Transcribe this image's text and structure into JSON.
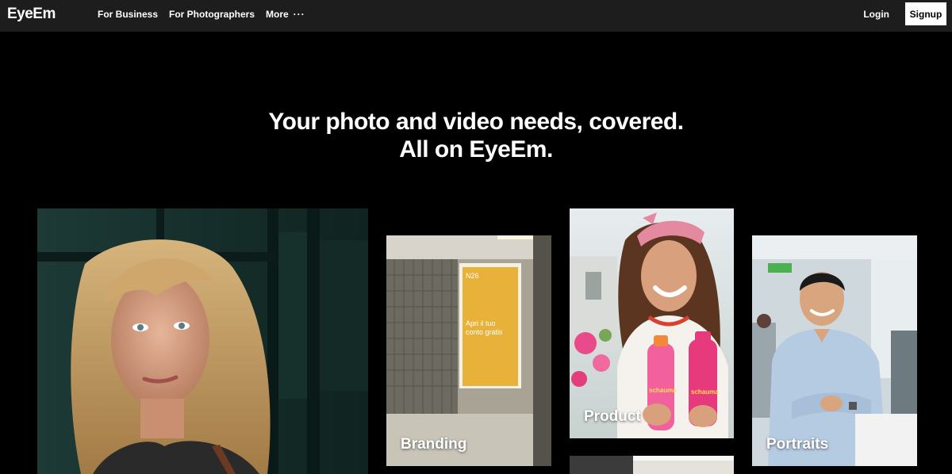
{
  "header": {
    "logo": "EyeEm",
    "nav": {
      "for_business": "For Business",
      "for_photographers": "For Photographers",
      "more": "More",
      "more_dots": "···"
    },
    "login": "Login",
    "signup": "Signup"
  },
  "hero": {
    "line1": "Your photo and video needs, covered.",
    "line2": "All on EyeEm."
  },
  "tiles": [
    {
      "label": ""
    },
    {
      "label": "Branding",
      "poster_logo": "N26",
      "poster_text_1": "Apri il tuo",
      "poster_text_2": "conto gratis"
    },
    {
      "label": "Product",
      "bottle_text": "schauma"
    },
    {
      "label": "Portraits"
    }
  ],
  "colors": {
    "nav_bg": "#1d1d1d",
    "page_bg": "#000000",
    "signup_bg": "#ffffff"
  }
}
